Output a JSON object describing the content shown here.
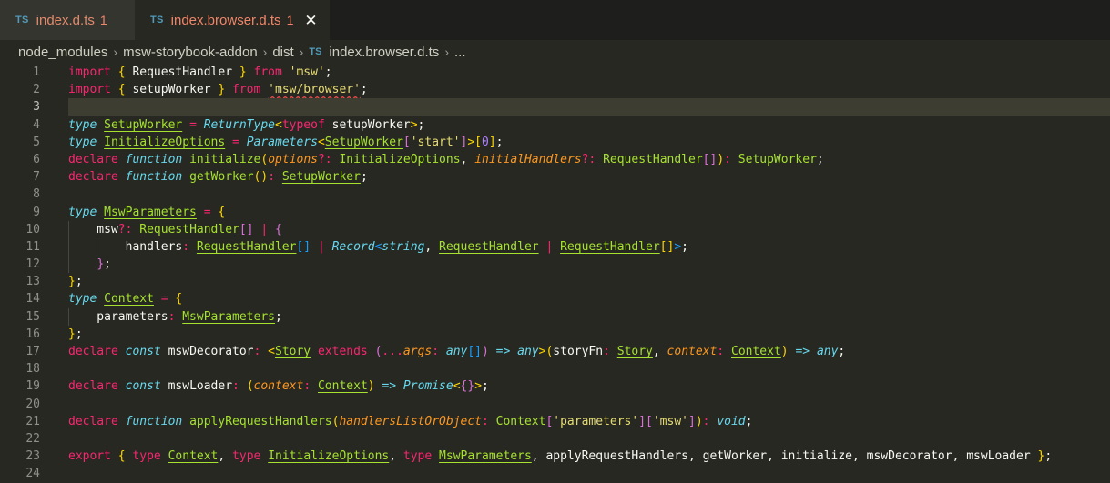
{
  "tabs": [
    {
      "badge": "TS",
      "name": "index.d.ts",
      "problems": "1",
      "close": ""
    },
    {
      "badge": "TS",
      "name": "index.browser.d.ts",
      "problems": "1",
      "close": "✕"
    }
  ],
  "breadcrumb": {
    "items": [
      "node_modules",
      "msw-storybook-addon",
      "dist"
    ],
    "file_badge": "TS",
    "file": "index.browser.d.ts",
    "more": "...",
    "separator": "›"
  },
  "editor": {
    "current_line": 3,
    "lines": [
      {
        "n": "1",
        "tokens": [
          [
            "kw",
            "import"
          ],
          [
            "pl",
            " "
          ],
          [
            "b1",
            "{"
          ],
          [
            "pl",
            " RequestHandler "
          ],
          [
            "b1",
            "}"
          ],
          [
            "pl",
            " "
          ],
          [
            "kw",
            "from"
          ],
          [
            "pl",
            " "
          ],
          [
            "str",
            "'msw'"
          ],
          [
            "pl",
            ";"
          ]
        ]
      },
      {
        "n": "2",
        "tokens": [
          [
            "kw",
            "import"
          ],
          [
            "pl",
            " "
          ],
          [
            "b1",
            "{"
          ],
          [
            "pl",
            " setupWorker "
          ],
          [
            "b1",
            "}"
          ],
          [
            "pl",
            " "
          ],
          [
            "kw",
            "from"
          ],
          [
            "pl",
            " "
          ],
          [
            "strsq",
            "'msw/browser'"
          ],
          [
            "pl",
            ";"
          ]
        ]
      },
      {
        "n": "3",
        "tokens": []
      },
      {
        "n": "4",
        "tokens": [
          [
            "st",
            "type"
          ],
          [
            "pl",
            " "
          ],
          [
            "ty",
            "SetupWorker"
          ],
          [
            "pl",
            " "
          ],
          [
            "op",
            "="
          ],
          [
            "pl",
            " "
          ],
          [
            "tyi",
            "ReturnType"
          ],
          [
            "b1",
            "<"
          ],
          [
            "kw",
            "typeof"
          ],
          [
            "pl",
            " setupWorker"
          ],
          [
            "b1",
            ">"
          ],
          [
            "pl",
            ";"
          ]
        ]
      },
      {
        "n": "5",
        "tokens": [
          [
            "st",
            "type"
          ],
          [
            "pl",
            " "
          ],
          [
            "ty",
            "InitializeOptions"
          ],
          [
            "pl",
            " "
          ],
          [
            "op",
            "="
          ],
          [
            "pl",
            " "
          ],
          [
            "tyi",
            "Parameters"
          ],
          [
            "b1",
            "<"
          ],
          [
            "ty",
            "SetupWorker"
          ],
          [
            "b2",
            "["
          ],
          [
            "str",
            "'start'"
          ],
          [
            "b2",
            "]"
          ],
          [
            "b1",
            ">"
          ],
          [
            "b1",
            "["
          ],
          [
            "num",
            "0"
          ],
          [
            "b1",
            "]"
          ],
          [
            "pl",
            ";"
          ]
        ]
      },
      {
        "n": "6",
        "tokens": [
          [
            "kw",
            "declare"
          ],
          [
            "pl",
            " "
          ],
          [
            "st",
            "function"
          ],
          [
            "pl",
            " "
          ],
          [
            "fn",
            "initialize"
          ],
          [
            "b1",
            "("
          ],
          [
            "par",
            "options"
          ],
          [
            "op",
            "?:"
          ],
          [
            "pl",
            " "
          ],
          [
            "ty",
            "InitializeOptions"
          ],
          [
            "pl",
            ", "
          ],
          [
            "par",
            "initialHandlers"
          ],
          [
            "op",
            "?:"
          ],
          [
            "pl",
            " "
          ],
          [
            "ty",
            "RequestHandler"
          ],
          [
            "b2",
            "[]"
          ],
          [
            "b1",
            ")"
          ],
          [
            "op",
            ":"
          ],
          [
            "pl",
            " "
          ],
          [
            "ty",
            "SetupWorker"
          ],
          [
            "pl",
            ";"
          ]
        ]
      },
      {
        "n": "7",
        "tokens": [
          [
            "kw",
            "declare"
          ],
          [
            "pl",
            " "
          ],
          [
            "st",
            "function"
          ],
          [
            "pl",
            " "
          ],
          [
            "fn",
            "getWorker"
          ],
          [
            "b1",
            "()"
          ],
          [
            "op",
            ":"
          ],
          [
            "pl",
            " "
          ],
          [
            "ty",
            "SetupWorker"
          ],
          [
            "pl",
            ";"
          ]
        ]
      },
      {
        "n": "8",
        "tokens": []
      },
      {
        "n": "9",
        "tokens": [
          [
            "st",
            "type"
          ],
          [
            "pl",
            " "
          ],
          [
            "ty",
            "MswParameters"
          ],
          [
            "pl",
            " "
          ],
          [
            "op",
            "="
          ],
          [
            "pl",
            " "
          ],
          [
            "b1",
            "{"
          ]
        ]
      },
      {
        "n": "10",
        "tokens": [
          [
            "pl",
            "    msw"
          ],
          [
            "op",
            "?:"
          ],
          [
            "pl",
            " "
          ],
          [
            "ty",
            "RequestHandler"
          ],
          [
            "b2",
            "[]"
          ],
          [
            "pl",
            " "
          ],
          [
            "op",
            "|"
          ],
          [
            "pl",
            " "
          ],
          [
            "b2",
            "{"
          ]
        ]
      },
      {
        "n": "11",
        "tokens": [
          [
            "pl",
            "        handlers"
          ],
          [
            "op",
            ":"
          ],
          [
            "pl",
            " "
          ],
          [
            "ty",
            "RequestHandler"
          ],
          [
            "b3",
            "[]"
          ],
          [
            "pl",
            " "
          ],
          [
            "op",
            "|"
          ],
          [
            "pl",
            " "
          ],
          [
            "tyi",
            "Record"
          ],
          [
            "b3",
            "<"
          ],
          [
            "tyi",
            "string"
          ],
          [
            "pl",
            ", "
          ],
          [
            "ty",
            "RequestHandler"
          ],
          [
            "pl",
            " "
          ],
          [
            "op",
            "|"
          ],
          [
            "pl",
            " "
          ],
          [
            "ty",
            "RequestHandler"
          ],
          [
            "b1",
            "[]"
          ],
          [
            "b3",
            ">"
          ],
          [
            "pl",
            ";"
          ]
        ]
      },
      {
        "n": "12",
        "tokens": [
          [
            "pl",
            "    "
          ],
          [
            "b2",
            "}"
          ],
          [
            "pl",
            ";"
          ]
        ]
      },
      {
        "n": "13",
        "tokens": [
          [
            "b1",
            "}"
          ],
          [
            "pl",
            ";"
          ]
        ]
      },
      {
        "n": "14",
        "tokens": [
          [
            "st",
            "type"
          ],
          [
            "pl",
            " "
          ],
          [
            "ty",
            "Context"
          ],
          [
            "pl",
            " "
          ],
          [
            "op",
            "="
          ],
          [
            "pl",
            " "
          ],
          [
            "b1",
            "{"
          ]
        ]
      },
      {
        "n": "15",
        "tokens": [
          [
            "pl",
            "    parameters"
          ],
          [
            "op",
            ":"
          ],
          [
            "pl",
            " "
          ],
          [
            "ty",
            "MswParameters"
          ],
          [
            "pl",
            ";"
          ]
        ]
      },
      {
        "n": "16",
        "tokens": [
          [
            "b1",
            "}"
          ],
          [
            "pl",
            ";"
          ]
        ]
      },
      {
        "n": "17",
        "tokens": [
          [
            "kw",
            "declare"
          ],
          [
            "pl",
            " "
          ],
          [
            "st",
            "const"
          ],
          [
            "pl",
            " mswDecorator"
          ],
          [
            "op",
            ":"
          ],
          [
            "pl",
            " "
          ],
          [
            "b1",
            "<"
          ],
          [
            "ty",
            "Story"
          ],
          [
            "pl",
            " "
          ],
          [
            "kw",
            "extends"
          ],
          [
            "pl",
            " "
          ],
          [
            "b2",
            "("
          ],
          [
            "op",
            "..."
          ],
          [
            "par",
            "args"
          ],
          [
            "op",
            ":"
          ],
          [
            "pl",
            " "
          ],
          [
            "tyi",
            "any"
          ],
          [
            "b3",
            "[]"
          ],
          [
            "b2",
            ")"
          ],
          [
            "pl",
            " "
          ],
          [
            "st",
            "=>"
          ],
          [
            "pl",
            " "
          ],
          [
            "tyi",
            "any"
          ],
          [
            "b1",
            ">"
          ],
          [
            "b1",
            "("
          ],
          [
            "pl",
            "storyFn"
          ],
          [
            "op",
            ":"
          ],
          [
            "pl",
            " "
          ],
          [
            "ty",
            "Story"
          ],
          [
            "pl",
            ", "
          ],
          [
            "par",
            "context"
          ],
          [
            "op",
            ":"
          ],
          [
            "pl",
            " "
          ],
          [
            "ty",
            "Context"
          ],
          [
            "b1",
            ")"
          ],
          [
            "pl",
            " "
          ],
          [
            "st",
            "=>"
          ],
          [
            "pl",
            " "
          ],
          [
            "tyi",
            "any"
          ],
          [
            "pl",
            ";"
          ]
        ]
      },
      {
        "n": "18",
        "tokens": []
      },
      {
        "n": "19",
        "tokens": [
          [
            "kw",
            "declare"
          ],
          [
            "pl",
            " "
          ],
          [
            "st",
            "const"
          ],
          [
            "pl",
            " mswLoader"
          ],
          [
            "op",
            ":"
          ],
          [
            "pl",
            " "
          ],
          [
            "b1",
            "("
          ],
          [
            "par",
            "context"
          ],
          [
            "op",
            ":"
          ],
          [
            "pl",
            " "
          ],
          [
            "ty",
            "Context"
          ],
          [
            "b1",
            ")"
          ],
          [
            "pl",
            " "
          ],
          [
            "st",
            "=>"
          ],
          [
            "pl",
            " "
          ],
          [
            "tyi",
            "Promise"
          ],
          [
            "b1",
            "<"
          ],
          [
            "b2",
            "{}"
          ],
          [
            "b1",
            ">"
          ],
          [
            "pl",
            ";"
          ]
        ]
      },
      {
        "n": "20",
        "tokens": []
      },
      {
        "n": "21",
        "tokens": [
          [
            "kw",
            "declare"
          ],
          [
            "pl",
            " "
          ],
          [
            "st",
            "function"
          ],
          [
            "pl",
            " "
          ],
          [
            "fn",
            "applyRequestHandlers"
          ],
          [
            "b1",
            "("
          ],
          [
            "par",
            "handlersListOrObject"
          ],
          [
            "op",
            ":"
          ],
          [
            "pl",
            " "
          ],
          [
            "ty",
            "Context"
          ],
          [
            "b2",
            "["
          ],
          [
            "str",
            "'parameters'"
          ],
          [
            "b2",
            "]"
          ],
          [
            "b2",
            "["
          ],
          [
            "str",
            "'msw'"
          ],
          [
            "b2",
            "]"
          ],
          [
            "b1",
            ")"
          ],
          [
            "op",
            ":"
          ],
          [
            "pl",
            " "
          ],
          [
            "tyi",
            "void"
          ],
          [
            "pl",
            ";"
          ]
        ]
      },
      {
        "n": "22",
        "tokens": []
      },
      {
        "n": "23",
        "tokens": [
          [
            "kw",
            "export"
          ],
          [
            "pl",
            " "
          ],
          [
            "b1",
            "{"
          ],
          [
            "pl",
            " "
          ],
          [
            "kw",
            "type"
          ],
          [
            "pl",
            " "
          ],
          [
            "ty",
            "Context"
          ],
          [
            "pl",
            ", "
          ],
          [
            "kw",
            "type"
          ],
          [
            "pl",
            " "
          ],
          [
            "ty",
            "InitializeOptions"
          ],
          [
            "pl",
            ", "
          ],
          [
            "kw",
            "type"
          ],
          [
            "pl",
            " "
          ],
          [
            "ty",
            "MswParameters"
          ],
          [
            "pl",
            ", applyRequestHandlers, getWorker, initialize, mswDecorator, mswLoader "
          ],
          [
            "b1",
            "}"
          ],
          [
            "pl",
            ";"
          ]
        ]
      },
      {
        "n": "24",
        "tokens": []
      }
    ]
  },
  "colors": {
    "background": "#272822",
    "keyword": "#f92672",
    "storage": "#66d9ef",
    "type": "#a6e22e",
    "parameter": "#fd971f",
    "string": "#e6db74",
    "number": "#ae81ff"
  }
}
